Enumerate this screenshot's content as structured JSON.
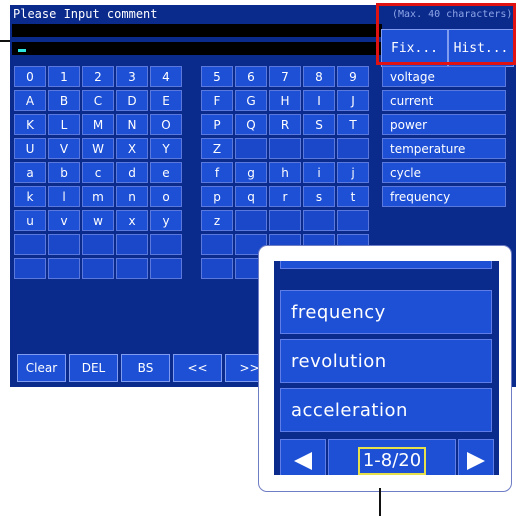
{
  "dialog": {
    "title": "Please Input comment",
    "char_limit_hint": "(Max. 40 characters)"
  },
  "buttons": {
    "fix": "Fix...",
    "history": "Hist..."
  },
  "keypad": {
    "rows": [
      [
        "0",
        "1",
        "2",
        "3",
        "4",
        "5",
        "6",
        "7",
        "8",
        "9"
      ],
      [
        "A",
        "B",
        "C",
        "D",
        "E",
        "F",
        "G",
        "H",
        "I",
        "J"
      ],
      [
        "K",
        "L",
        "M",
        "N",
        "O",
        "P",
        "Q",
        "R",
        "S",
        "T"
      ],
      [
        "U",
        "V",
        "W",
        "X",
        "Y",
        "Z",
        "",
        "",
        "",
        ""
      ],
      [
        "a",
        "b",
        "c",
        "d",
        "e",
        "f",
        "g",
        "h",
        "i",
        "j"
      ],
      [
        "k",
        "l",
        "m",
        "n",
        "o",
        "p",
        "q",
        "r",
        "s",
        "t"
      ],
      [
        "u",
        "v",
        "w",
        "x",
        "y",
        "z",
        "",
        "",
        "",
        ""
      ],
      [
        "",
        "",
        "",
        "",
        "",
        "",
        "",
        "",
        "",
        ""
      ],
      [
        "",
        "",
        "",
        "",
        "",
        "",
        "",
        "",
        "",
        ""
      ]
    ]
  },
  "word_list": [
    "voltage",
    "current",
    "power",
    "temperature",
    "cycle",
    "frequency"
  ],
  "function_keys": {
    "clear": "Clear",
    "del": "DEL",
    "bs": "BS",
    "left": "<<",
    "right": ">>"
  },
  "magnified": {
    "items": [
      "frequency",
      "revolution",
      "acceleration"
    ],
    "page_indicator": "1-8/20",
    "prev_icon": "left-triangle-icon",
    "next_icon": "right-triangle-icon"
  },
  "colors": {
    "panel": "#0a2a8c",
    "key": "#1e50d6",
    "highlight": "#e11212",
    "page_box": "#e6e04a"
  }
}
